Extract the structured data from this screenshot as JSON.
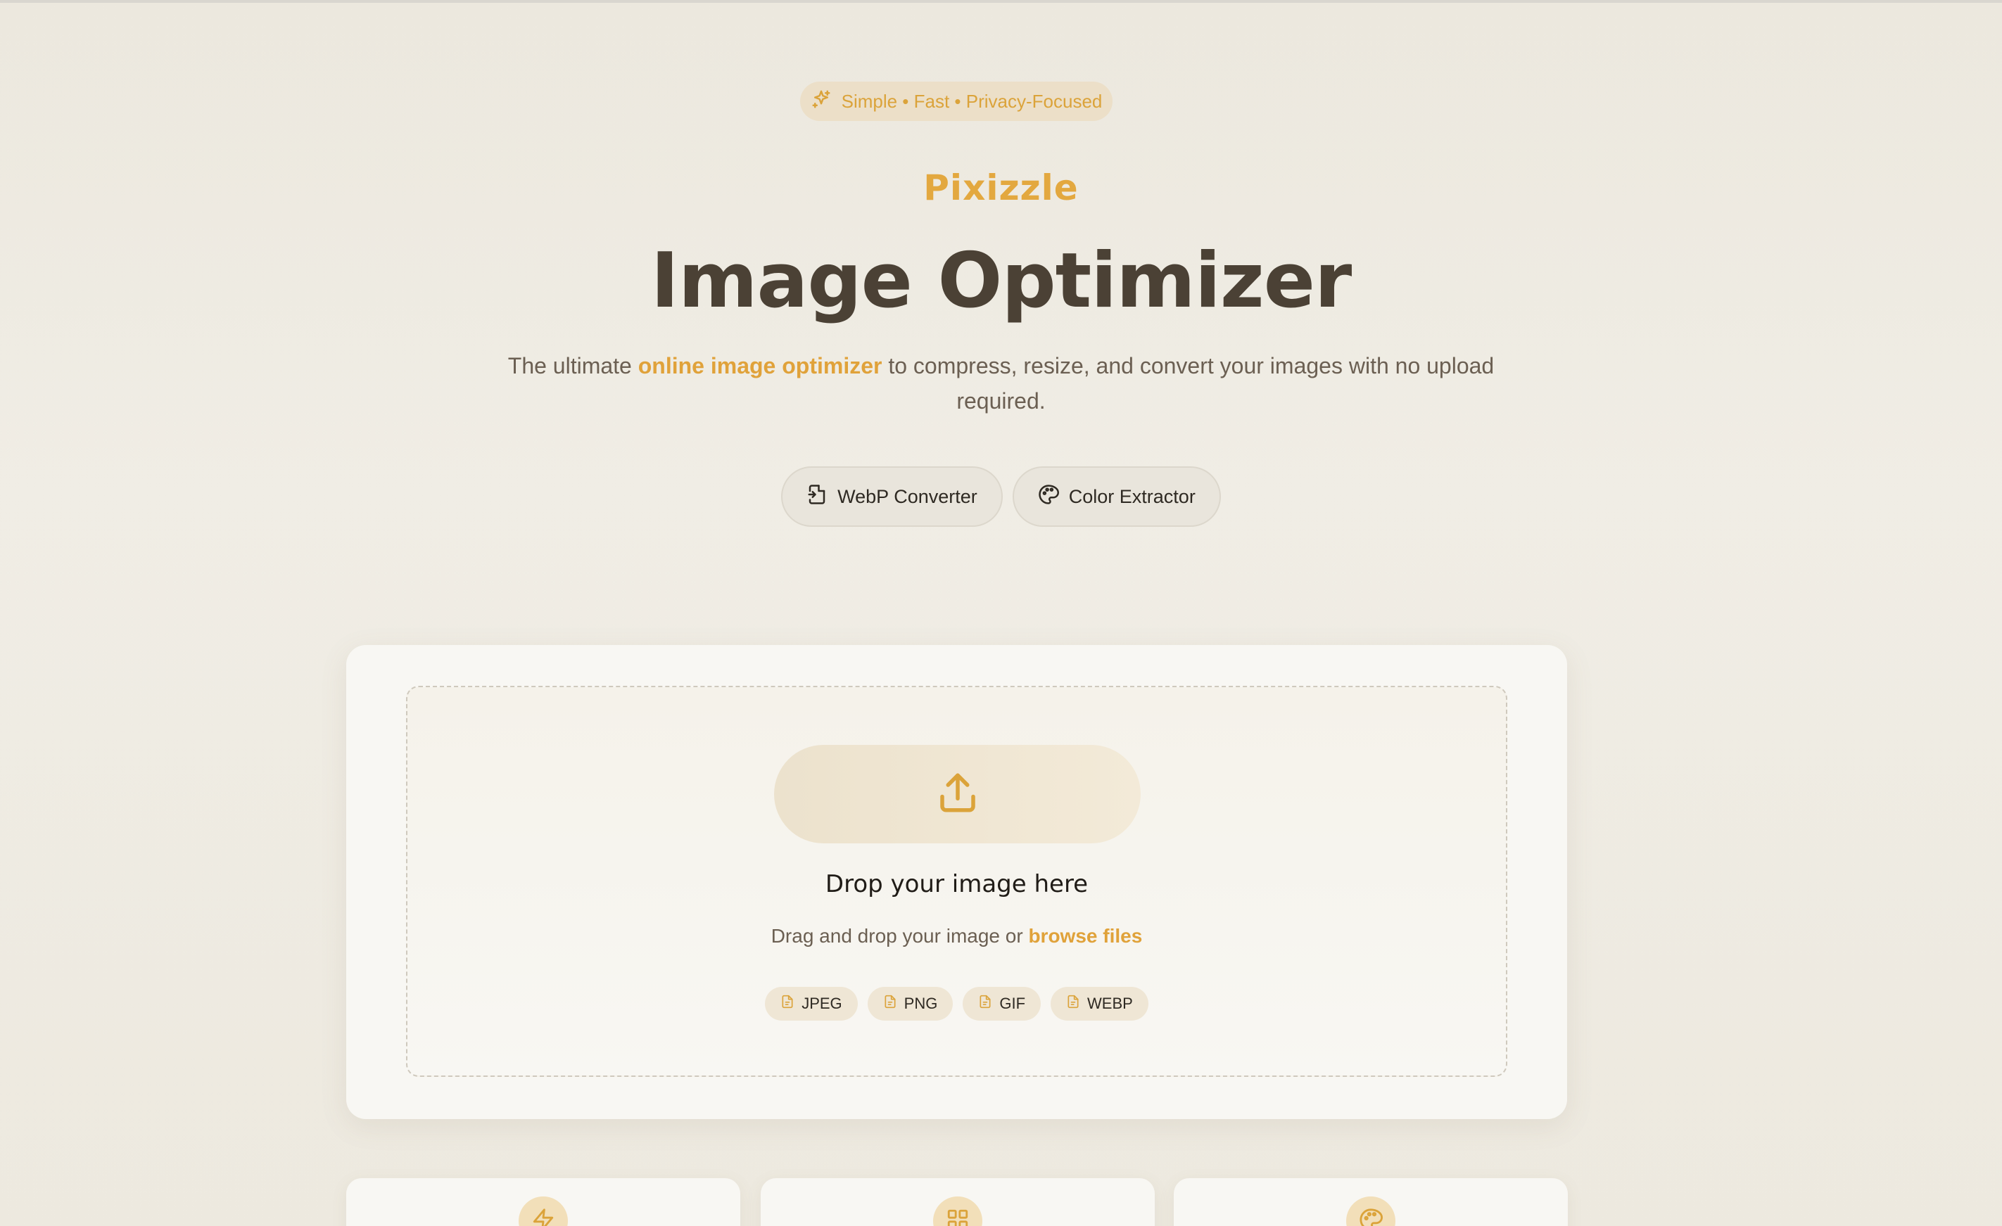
{
  "badge": {
    "text": "Simple • Fast • Privacy-Focused",
    "icon": "sparkles-icon"
  },
  "brand": "Pixizzle",
  "title": "Image Optimizer",
  "subtitle": {
    "prefix": "The ultimate ",
    "highlight": "online image optimizer",
    "suffix": " to compress, resize, and convert your images with no upload required."
  },
  "tools": [
    {
      "label": "WebP Converter",
      "icon": "file-convert-icon"
    },
    {
      "label": "Color Extractor",
      "icon": "palette-icon"
    }
  ],
  "dropzone": {
    "icon": "upload-icon",
    "title": "Drop your image here",
    "sub_prefix": "Drag and drop your image or ",
    "browse_label": "browse files",
    "formats": [
      "JPEG",
      "PNG",
      "GIF",
      "WEBP"
    ]
  },
  "features": [
    {
      "icon": "zap-icon"
    },
    {
      "icon": "grid-icon"
    },
    {
      "icon": "palette-icon"
    }
  ],
  "colors": {
    "accent": "#e0a23a",
    "background": "#ece8de",
    "title": "#4b4135",
    "card": "#f8f7f3"
  }
}
